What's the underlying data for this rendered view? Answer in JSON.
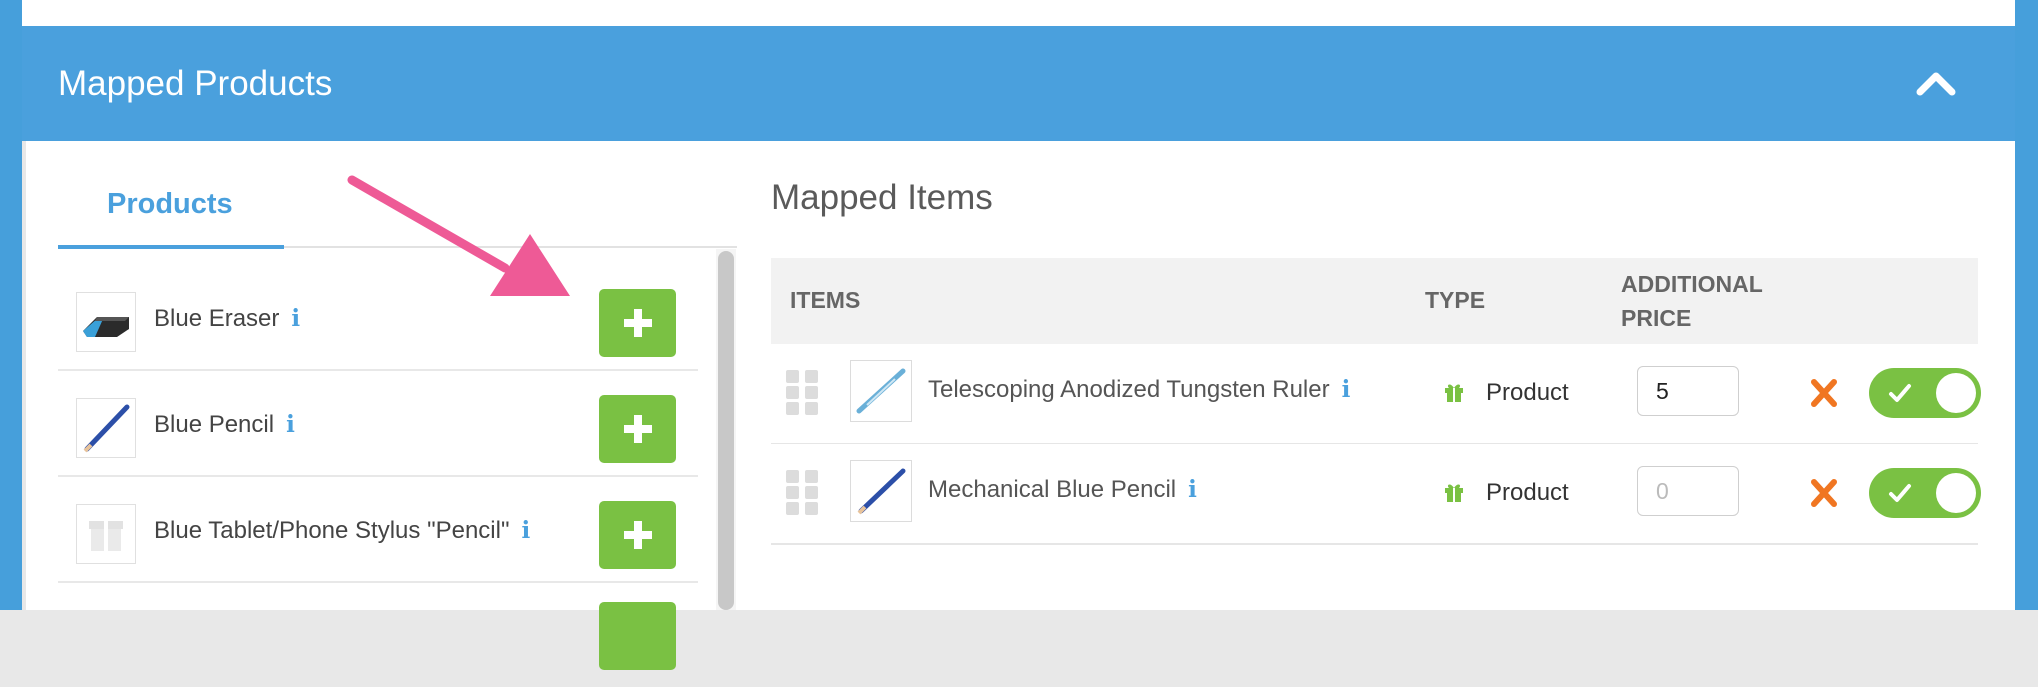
{
  "panel": {
    "title": "Mapped Products"
  },
  "products_tab": {
    "label": "Products"
  },
  "products": [
    {
      "name": "Blue Eraser",
      "thumb_icon": "eraser-thumb"
    },
    {
      "name": "Blue Pencil",
      "thumb_icon": "pencil-thumb"
    },
    {
      "name": "Blue Tablet/Phone Stylus \"Pencil\"",
      "thumb_icon": "gift-placeholder-thumb"
    }
  ],
  "mapped_items": {
    "title": "Mapped Items",
    "columns": {
      "items": "ITEMS",
      "type": "TYPE",
      "additional_price_line1": "ADDITIONAL",
      "additional_price_line2": "PRICE"
    },
    "rows": [
      {
        "name": "Telescoping Anodized Tungsten Ruler",
        "type": "Product",
        "price_value": "5",
        "price_placeholder": "",
        "enabled": true
      },
      {
        "name": "Mechanical Blue Pencil",
        "type": "Product",
        "price_value": "",
        "price_placeholder": "0",
        "enabled": true
      }
    ]
  },
  "icons": {
    "info": "i",
    "add": "plus-icon",
    "collapse": "chevron-up-icon",
    "remove": "x-icon",
    "toggle_check": "check-icon",
    "type": "gift-icon",
    "drag": "drag-handle-icon"
  },
  "colors": {
    "header_blue": "#4aa0dd",
    "add_green": "#7ac143",
    "remove_orange": "#f07622",
    "annotation_pink": "#ee5a96"
  }
}
